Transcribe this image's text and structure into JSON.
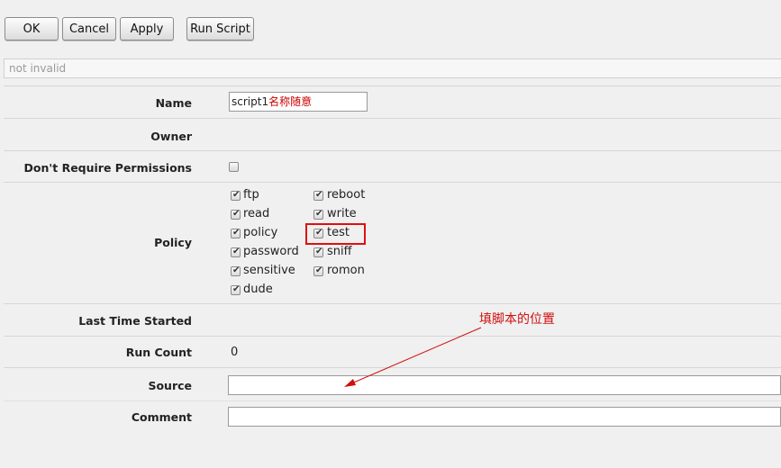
{
  "toolbar": {
    "ok_label": "OK",
    "cancel_label": "Cancel",
    "apply_label": "Apply",
    "run_script_label": "Run Script"
  },
  "status_text": "not invalid",
  "fields": {
    "name": {
      "label": "Name",
      "value": "script1",
      "note": "名称随意"
    },
    "owner": {
      "label": "Owner",
      "value": ""
    },
    "dont_require_permissions": {
      "label": "Don't Require Permissions",
      "checked": false
    },
    "policy": {
      "label": "Policy",
      "items": [
        {
          "name": "ftp",
          "checked": true
        },
        {
          "name": "reboot",
          "checked": true
        },
        {
          "name": "read",
          "checked": true
        },
        {
          "name": "write",
          "checked": true
        },
        {
          "name": "policy",
          "checked": true
        },
        {
          "name": "test",
          "checked": true
        },
        {
          "name": "password",
          "checked": true
        },
        {
          "name": "sniff",
          "checked": true
        },
        {
          "name": "sensitive",
          "checked": true
        },
        {
          "name": "romon",
          "checked": true
        },
        {
          "name": "dude",
          "checked": true
        }
      ]
    },
    "last_time_started": {
      "label": "Last Time Started",
      "value": ""
    },
    "run_count": {
      "label": "Run Count",
      "value": "0"
    },
    "source": {
      "label": "Source",
      "value": ""
    },
    "comment": {
      "label": "Comment",
      "value": ""
    }
  },
  "annotation": {
    "text": "填脚本的位置",
    "color": "#d01010"
  },
  "colors": {
    "highlight": "#e01010",
    "annotation": "#d01010"
  }
}
